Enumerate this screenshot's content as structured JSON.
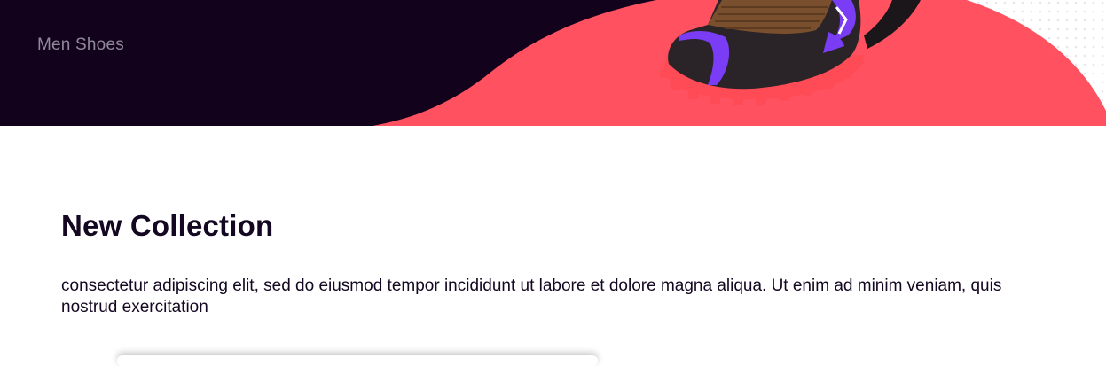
{
  "hero": {
    "label": "Men Shoes",
    "image": "sneaker-product-image",
    "colors": {
      "dark": "#12021c",
      "accent": "#ff5160",
      "shoe_purple": "#7a3cf5"
    }
  },
  "collection": {
    "title": "New Collection",
    "description": "consectetur adipiscing elit, sed do eiusmod tempor incididunt ut labore et dolore magna aliqua. Ut enim ad minim veniam, quis nostrud exercitation"
  }
}
